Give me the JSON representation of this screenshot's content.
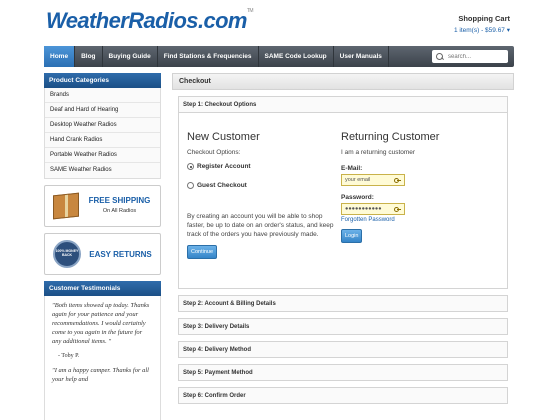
{
  "header": {
    "logo_text": "WeatherRadios.com",
    "logo_tm": "TM",
    "cart_title": "Shopping Cart",
    "cart_info": "1 item(s) - $59.67 ▾"
  },
  "nav": {
    "items": [
      "Home",
      "Blog",
      "Buying Guide",
      "Find Stations & Frequencies",
      "SAME Code Lookup",
      "User Manuals"
    ],
    "search_placeholder": "search..."
  },
  "sidebar": {
    "categories_title": "Product Categories",
    "categories": [
      "Brands",
      "Deaf and Hard of Hearing",
      "Desktop Weather Radios",
      "Hand Crank Radios",
      "Portable Weather Radios",
      "SAME Weather Radios"
    ],
    "promo1": {
      "title": "FREE SHIPPING",
      "sub": "On All Radios"
    },
    "promo2": {
      "badge": "100% MONEY BACK",
      "title": "EASY RETURNS"
    },
    "testimonials_title": "Customer Testimonials",
    "testimonial1": "\"Both items showed up today. Thanks again for your patience and your recommendations. I would certainly come to you again in the future for any additional items. \"",
    "testimonial1_author": "- Toby P.",
    "testimonial2": "\"I am a happy camper. Thanks for all your help and"
  },
  "checkout": {
    "title": "Checkout",
    "step1": "Step 1: Checkout Options",
    "new_customer": {
      "heading": "New Customer",
      "options_label": "Checkout Options:",
      "register": "Register Account",
      "guest": "Guest Checkout",
      "description": "By creating an account you will be able to shop faster, be up to date on an order's status, and keep track of the orders you have previously made.",
      "continue": "Continue"
    },
    "returning_customer": {
      "heading": "Returning Customer",
      "sub": "I am a returning customer",
      "email_label": "E-Mail:",
      "email_value": "your email",
      "password_label": "Password:",
      "password_value": "●●●●●●●●●●●",
      "forgotten": "Forgotten Password",
      "login": "Login"
    },
    "steps": [
      "Step 2: Account & Billing Details",
      "Step 3: Delivery Details",
      "Step 4: Delivery Method",
      "Step 5: Payment Method",
      "Step 6: Confirm Order"
    ]
  }
}
